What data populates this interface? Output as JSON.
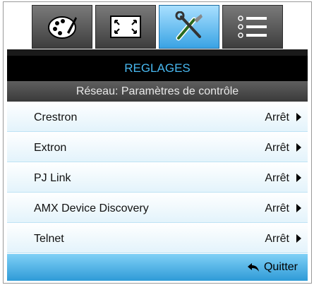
{
  "tabs": [
    {
      "icon": "palette-icon",
      "active": false
    },
    {
      "icon": "screen-resize-icon",
      "active": false
    },
    {
      "icon": "tools-icon",
      "active": true
    },
    {
      "icon": "menu-list-icon",
      "active": false
    }
  ],
  "header": {
    "title": "REGLAGES"
  },
  "subheader": {
    "title": "Réseau: Paramètres de contrôle"
  },
  "items": [
    {
      "label": "Crestron",
      "value": "Arrêt"
    },
    {
      "label": "Extron",
      "value": "Arrêt"
    },
    {
      "label": "PJ Link",
      "value": "Arrêt"
    },
    {
      "label": "AMX Device Discovery",
      "value": "Arrêt"
    },
    {
      "label": "Telnet",
      "value": "Arrêt"
    }
  ],
  "footer": {
    "quit_label": "Quitter"
  },
  "colors": {
    "accent": "#48b8f0",
    "active_tab": "#3aa3e4",
    "row_bg": "#e3f3fb"
  }
}
